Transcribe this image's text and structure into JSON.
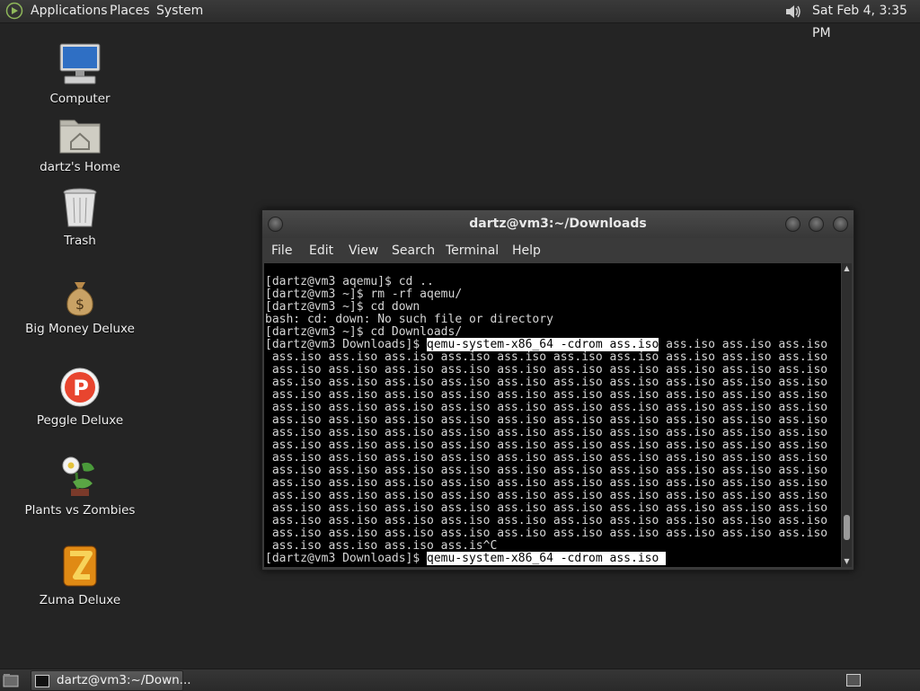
{
  "top_panel": {
    "menus": [
      "Applications",
      "Places",
      "System"
    ],
    "clock": "Sat Feb  4,  3:35 PM"
  },
  "desktop": {
    "icons": [
      {
        "label": "Computer",
        "icon": "computer-icon"
      },
      {
        "label": "dartz's Home",
        "icon": "home-folder-icon"
      },
      {
        "label": "Trash",
        "icon": "trash-icon"
      },
      {
        "label": "Big Money Deluxe",
        "icon": "money-bag-icon"
      },
      {
        "label": "Peggle Deluxe",
        "icon": "peggle-icon"
      },
      {
        "label": "Plants vs Zombies",
        "icon": "plants-vs-zombies-icon"
      },
      {
        "label": "Zuma Deluxe",
        "icon": "zuma-icon"
      }
    ]
  },
  "terminal": {
    "title": "dartz@vm3:~/Downloads",
    "menu": [
      "File",
      "Edit",
      "View",
      "Search",
      "Terminal",
      "Help"
    ],
    "lines": [
      "[dartz@vm3 aqemu]$ cd ..",
      "[dartz@vm3 ~]$ rm -rf aqemu/",
      "[dartz@vm3 ~]$ cd down",
      "bash: cd: down: No such file or directory",
      "[dartz@vm3 ~]$ cd Downloads/"
    ],
    "prompt": "[dartz@vm3 Downloads]$ ",
    "highlighted_command": "qemu-system-x86_64 -cdrom ass.iso",
    "repeat_word": "ass.iso",
    "last_partial": " ass.iso ass.iso ass.iso ass.is^C",
    "final_command": "qemu-system-x86_64 -cdrom ass.iso "
  },
  "taskbar": {
    "task_label": "dartz@vm3:~/Down..."
  },
  "colors": {
    "desktop_bg": "#242424",
    "terminal_bg": "#000000",
    "terminal_fg": "#d6d6d6"
  }
}
